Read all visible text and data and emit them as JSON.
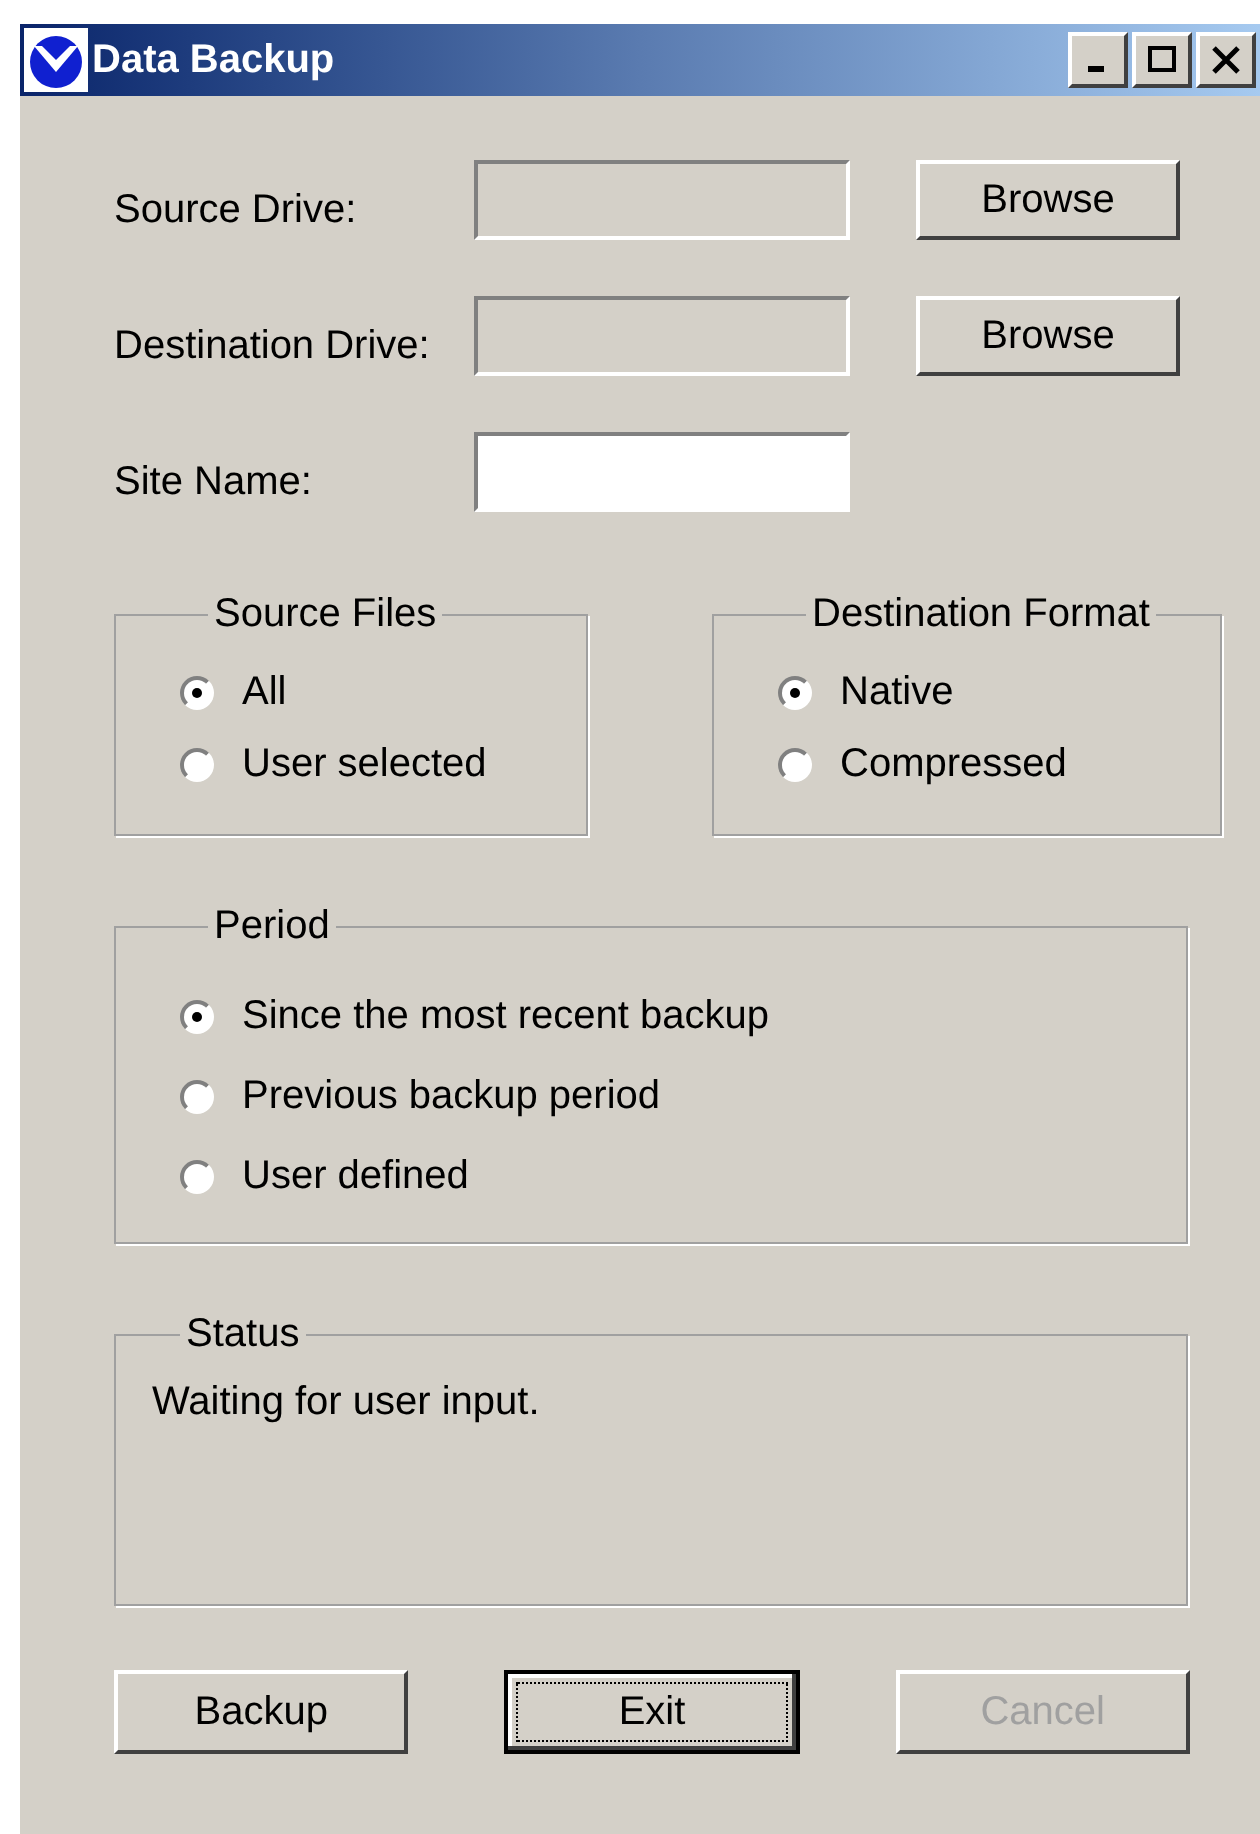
{
  "window": {
    "title": "Data Backup"
  },
  "drive_fields": [
    {
      "label": "Source Drive:",
      "button": "Browse",
      "enabled": false
    },
    {
      "label": "Destination Drive:",
      "button": "Browse",
      "enabled": false
    }
  ],
  "site_name": {
    "label": "Site Name:"
  },
  "groups": [
    {
      "title": "Source Files",
      "options": [
        {
          "label": "All",
          "selected": true
        },
        {
          "label": "User selected",
          "selected": false
        }
      ]
    },
    {
      "title": "Destination Format",
      "options": [
        {
          "label": "Native",
          "selected": true
        },
        {
          "label": "Compressed",
          "selected": false
        }
      ]
    }
  ],
  "period": {
    "title": "Period",
    "options": [
      {
        "label": "Since the most recent backup",
        "selected": true
      },
      {
        "label": "Previous backup period",
        "selected": false
      },
      {
        "label": "User defined",
        "selected": false
      }
    ]
  },
  "status": {
    "title": "Status",
    "text": "Waiting for user input."
  },
  "buttons": [
    {
      "label": "Backup",
      "disabled": false,
      "focused": false
    },
    {
      "label": "Exit",
      "disabled": false,
      "focused": true
    },
    {
      "label": "Cancel",
      "disabled": true,
      "focused": false
    }
  ]
}
